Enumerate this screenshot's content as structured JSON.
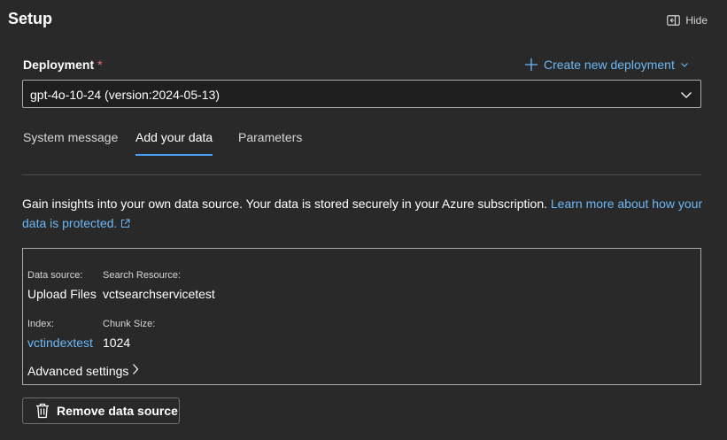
{
  "header": {
    "title": "Setup",
    "hide_label": "Hide"
  },
  "deployment": {
    "label": "Deployment",
    "required_marker": "*",
    "create_link": "Create new deployment",
    "selected_value": "gpt-4o-10-24 (version:2024-05-13)"
  },
  "tabs": [
    {
      "label": "System message",
      "active": false
    },
    {
      "label": "Add your data",
      "active": true
    },
    {
      "label": "Parameters",
      "active": false
    }
  ],
  "description": {
    "text": "Gain insights into your own data source. Your data is stored securely in your Azure subscription.",
    "link_text": "Learn more about how your data is protected."
  },
  "data_source": {
    "data_source_label": "Data source:",
    "data_source_value": "Upload Files",
    "search_resource_label": "Search Resource:",
    "search_resource_value": "vctsearchservicetest",
    "index_label": "Index:",
    "index_value": "vctindextest",
    "chunk_size_label": "Chunk Size:",
    "chunk_size_value": "1024",
    "advanced_settings": "Advanced settings"
  },
  "actions": {
    "remove_label": "Remove data source"
  },
  "colors": {
    "background": "#292929",
    "accent": "#479ef5",
    "link": "#6cb8f6",
    "required": "#f1707b"
  },
  "icons": {
    "hide": "panel-collapse-icon",
    "create": "plus-icon",
    "create_chevron": "chevron-down-icon",
    "select": "chevron-down-icon",
    "external_link": "open-external-icon",
    "advanced": "chevron-right-icon",
    "remove": "trash-icon"
  }
}
